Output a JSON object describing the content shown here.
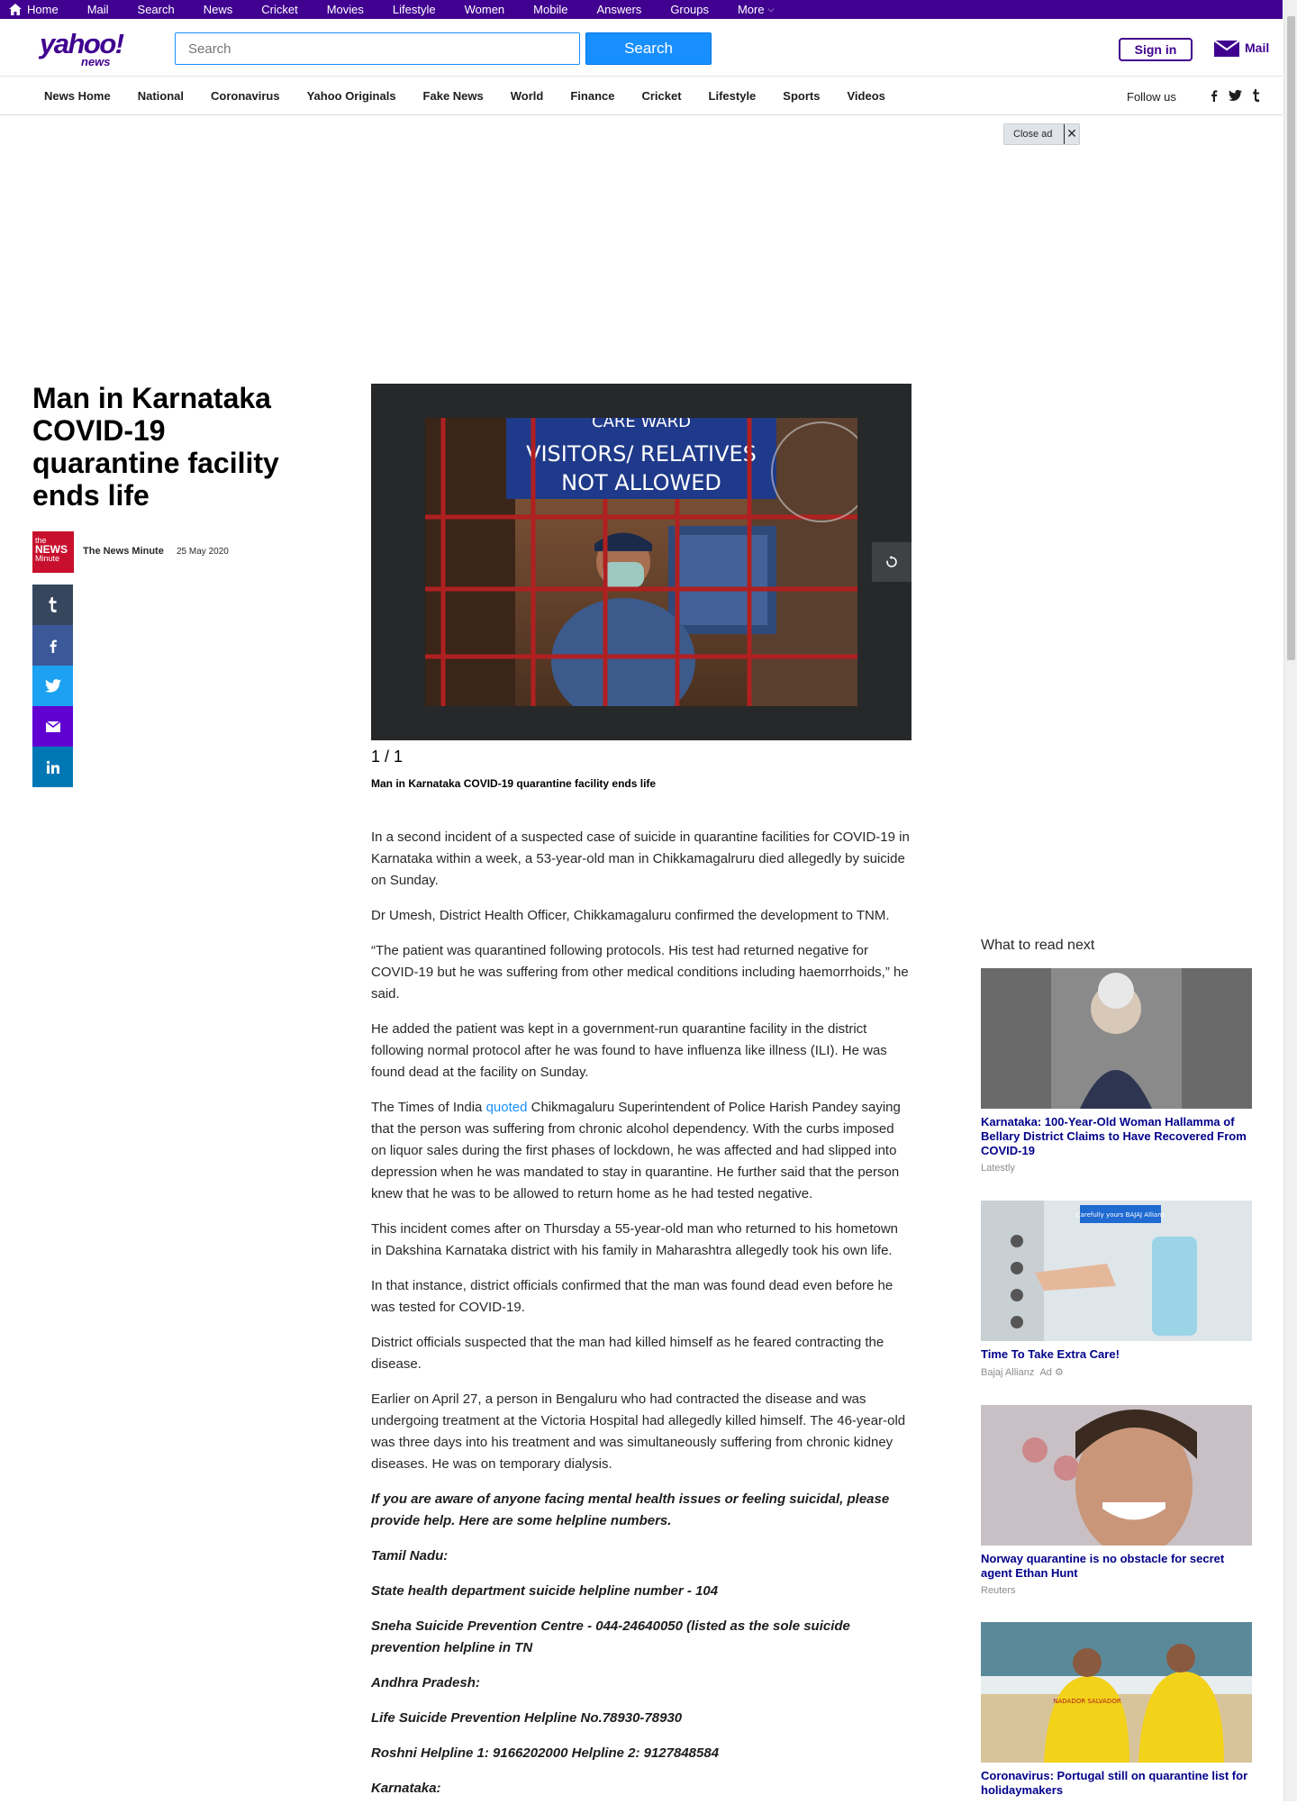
{
  "topbar": {
    "items": [
      "Home",
      "Mail",
      "Search",
      "News",
      "Cricket",
      "Movies",
      "Lifestyle",
      "Women",
      "Mobile",
      "Answers",
      "Groups",
      "More"
    ]
  },
  "header": {
    "logo_main": "yahoo!",
    "logo_sub": "news",
    "search_placeholder": "Search",
    "search_button": "Search",
    "sign_in": "Sign in",
    "mail": "Mail"
  },
  "nav": {
    "items": [
      "News Home",
      "National",
      "Coronavirus",
      "Yahoo Originals",
      "Fake News",
      "World",
      "Finance",
      "Cricket",
      "Lifestyle",
      "Sports",
      "Videos"
    ],
    "follow_label": "Follow us"
  },
  "ad": {
    "close_label": "Close ad"
  },
  "article": {
    "headline": "Man in Karnataka COVID-19 quarantine facility ends life",
    "provider_logo_top": "the",
    "provider_logo_mid": "NEWS",
    "provider_logo_bot": "Minute",
    "provider": "The News Minute",
    "date": "25 May 2020",
    "photo_sign_top": "CARE WARD",
    "photo_sign_line1": "VISITORS/ RELATIVES",
    "photo_sign_line2": "NOT ALLOWED",
    "slide_count": "1 / 1",
    "slide_caption": "Man in Karnataka COVID-19 quarantine facility ends life",
    "paragraphs": [
      "In a second incident of a suspected case of suicide in quarantine facilities for COVID-19 in Karnataka within a week, a 53-year-old man in Chikkamagalruru died allegedly by suicide on Sunday.",
      "Dr Umesh, District Health Officer, Chikkamagaluru confirmed the development to TNM.",
      "“The patient was quarantined following protocols. His test had returned negative for COVID-19 but he was suffering from other medical conditions including haemorrhoids,” he said.",
      "He added the patient  was kept in a government-run quarantine facility in the district following normal protocol after he was found to have influenza like illness (ILI). He was found dead at the facility on Sunday."
    ],
    "toi_pre": "The Times of India ",
    "toi_link": "quoted",
    "toi_post": " Chikmagaluru Superintendent of Police Harish Pandey saying that the person was suffering from chronic alcohol dependency. With the curbs imposed on liquor sales during the first phases of lockdown, he was affected and had slipped into depression when he was mandated to stay in quarantine. He further said that the person knew that he was to be allowed to return home as he had tested negative.",
    "paragraphs_after": [
      "This incident comes after on Thursday a 55-year-old man who returned to his hometown in Dakshina Karnataka district with his family in Maharashtra allegedly took his own life.",
      "In that instance, district officials confirmed that the man was found dead even before he was tested for COVID-19.",
      "District officials suspected that the man had killed himself as he feared contracting the disease.",
      "Earlier on April 27, a person in Bengaluru who had contracted the disease and was undergoing treatment at the Victoria Hospital had allegedly killed himself. The 46-year-old was three days into his treatment and was simultaneously suffering from chronic kidney diseases. He was on temporary dialysis."
    ],
    "helpline": [
      "If you are aware of anyone facing mental health issues or feeling suicidal, please provide help. Here are some helpline numbers.",
      "Tamil Nadu:",
      "State health department suicide helpline number - 104",
      "Sneha Suicide Prevention Centre - 044-24640050 (listed as the sole suicide prevention helpline in TN",
      "Andhra Pradesh:",
      "Life Suicide Prevention Helpline No.78930-78930",
      "Roshni Helpline 1: 9166202000 Helpline 2: 9127848584",
      "Karnataka:"
    ]
  },
  "rail": {
    "heading": "What to read next",
    "cards": [
      {
        "title": "Karnataka: 100-Year-Old Woman Hallamma of Bellary District Claims to Have Recovered From COVID-19",
        "source": "Latestly"
      },
      {
        "title": "Time To Take Extra Care!",
        "source": "Bajaj Allianz",
        "ad": "Ad",
        "img_text": "Carefully yours  BAJAJ Allianz"
      },
      {
        "title": "Norway quarantine is no obstacle for secret agent Ethan Hunt",
        "source": "Reuters"
      },
      {
        "title": "Coronavirus: Portugal still on quarantine list for holidaymakers",
        "source": "",
        "img_text": "NADADOR SALVADOR"
      }
    ]
  },
  "colors": {
    "brand": "#400090",
    "accent": "#188fff",
    "link": "#00008b"
  }
}
